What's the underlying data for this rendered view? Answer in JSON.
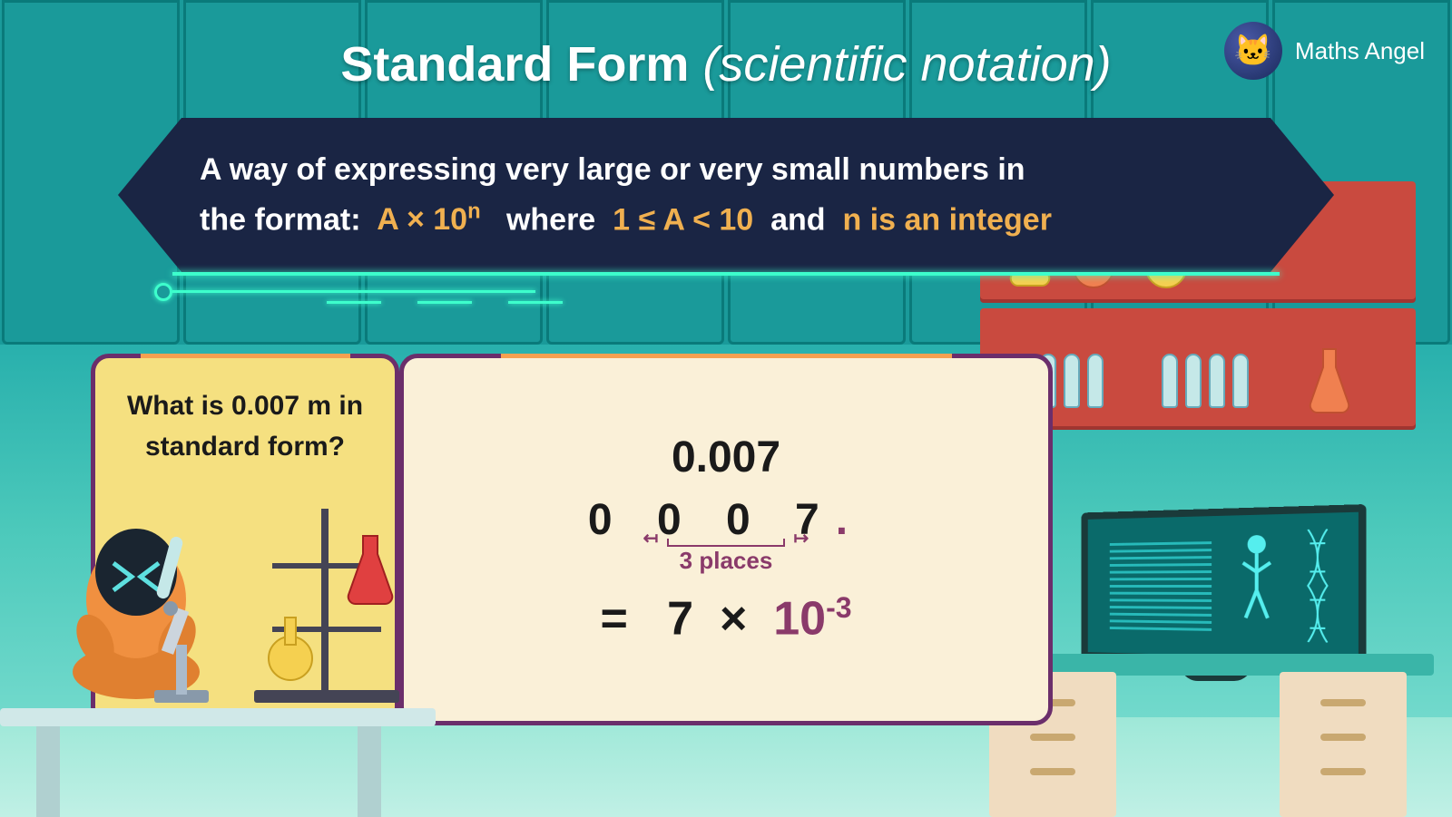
{
  "brand": "Maths Angel",
  "title_main": "Standard Form",
  "title_sub": "(scientific notation)",
  "definition": {
    "line1": "A way of expressing very large or very small numbers in",
    "line2_prefix": "the format:",
    "formula": "A × 10",
    "formula_exp": "n",
    "where": "where",
    "condition": "1 ≤ A < 10",
    "and": "and",
    "integer": "n is an integer"
  },
  "question": "What is 0.007 m in standard form?",
  "work": {
    "original": "0.007",
    "shifted_digits": "0 0 0 7",
    "shifted_dot": ".",
    "places_label": "3 places",
    "eq": "=",
    "coefficient": "7",
    "times": "×",
    "base": "10",
    "exponent": "-3"
  }
}
